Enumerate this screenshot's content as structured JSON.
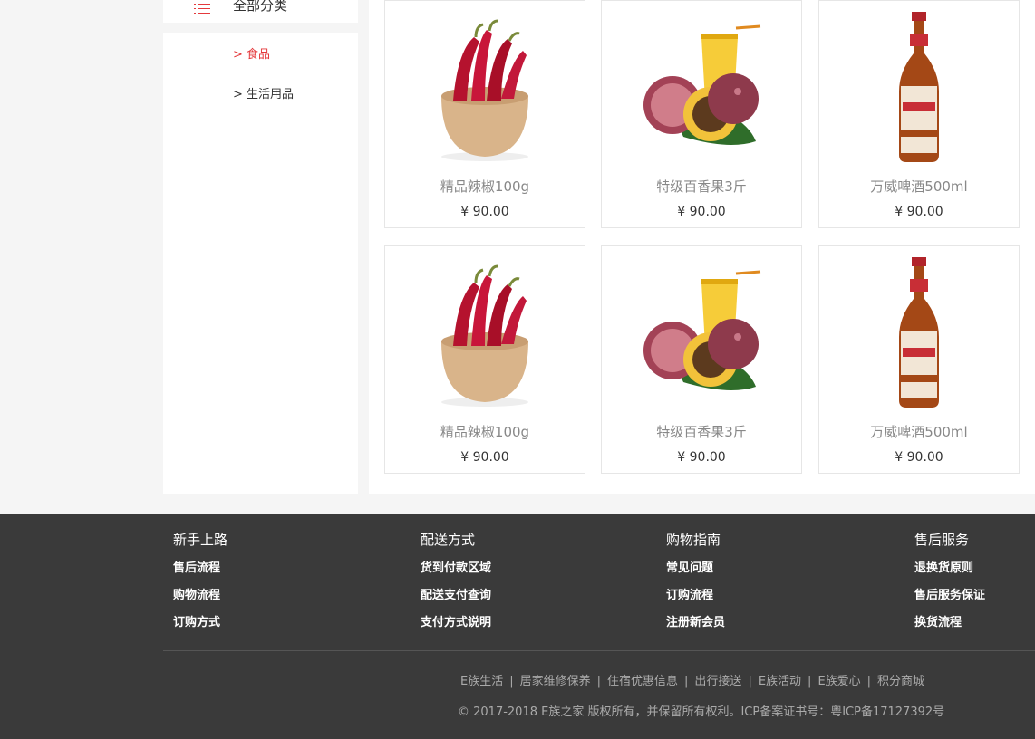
{
  "sidebar": {
    "header_label": "全部分类",
    "items": [
      {
        "label": "> 食品",
        "active": true
      },
      {
        "label": "> 生活用品",
        "active": false
      }
    ]
  },
  "products": [
    {
      "name": "精品辣椒100g",
      "price": "¥ 90.00",
      "image": "chili-pepper-bowl"
    },
    {
      "name": "特级百香果3斤",
      "price": "¥ 90.00",
      "image": "passion-fruit"
    },
    {
      "name": "万威啤酒500ml",
      "price": "¥ 90.00",
      "image": "beer-bottle"
    },
    {
      "name": "精品辣椒100g",
      "price": "¥ 90.00",
      "image": "chili-pepper-bowl"
    },
    {
      "name": "特级百香果3斤",
      "price": "¥ 90.00",
      "image": "passion-fruit"
    },
    {
      "name": "万威啤酒500ml",
      "price": "¥ 90.00",
      "image": "beer-bottle"
    }
  ],
  "footer": {
    "columns": [
      {
        "title": "新手上路",
        "links": [
          "售后流程",
          "购物流程",
          "订购方式"
        ]
      },
      {
        "title": "配送方式",
        "links": [
          "货到付款区域",
          "配送支付查询",
          "支付方式说明"
        ]
      },
      {
        "title": "购物指南",
        "links": [
          "常见问题",
          "订购流程",
          "注册新会员"
        ]
      },
      {
        "title": "售后服务",
        "links": [
          "退换货原则",
          "售后服务保证",
          "换货流程"
        ]
      }
    ],
    "bottom_links": [
      "E族生活",
      "居家维修保养",
      "住宿优惠信息",
      "出行接送",
      "E族活动",
      "E族爱心",
      "积分商城"
    ],
    "separator": "|",
    "copyright": "© 2017-2018  E族之家  版权所有，并保留所有权利。ICP备案证书号：粤ICP备17127392号"
  },
  "colors": {
    "accent": "#e4393c",
    "footer_bg": "#3a3a3a",
    "page_bg": "#f5f5f5"
  }
}
